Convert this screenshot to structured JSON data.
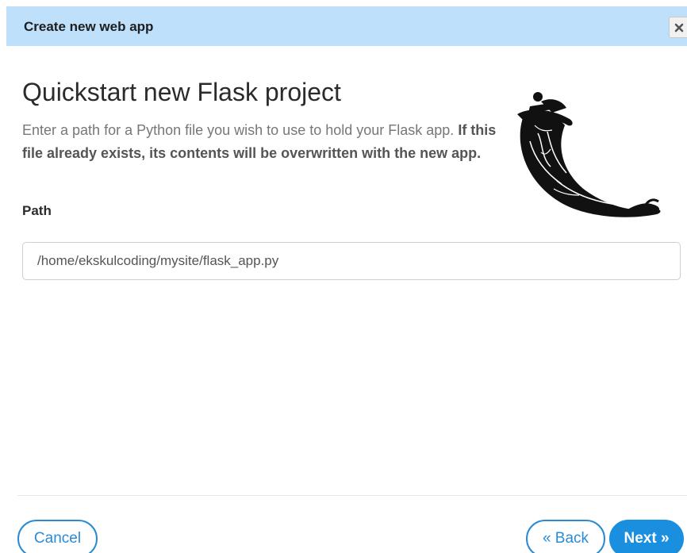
{
  "dialog": {
    "title": "Create new web app",
    "close_icon": "close-icon"
  },
  "content": {
    "heading": "Quickstart new Flask project",
    "description_normal": "Enter a path for a Python file you wish to use to hold your Flask app. ",
    "description_bold": "If this file already exists, its contents will be overwritten with the new app.",
    "logo_icon": "flask-horn-logo"
  },
  "form": {
    "path_label": "Path",
    "path_value": "/home/ekskulcoding/mysite/flask_app.py"
  },
  "footer": {
    "cancel_label": "Cancel",
    "back_label": "« Back",
    "next_label": "Next »"
  },
  "colors": {
    "header_bg": "#bfe0fb",
    "accent": "#1a8fe0",
    "button_outline": "#2a8bd5"
  }
}
